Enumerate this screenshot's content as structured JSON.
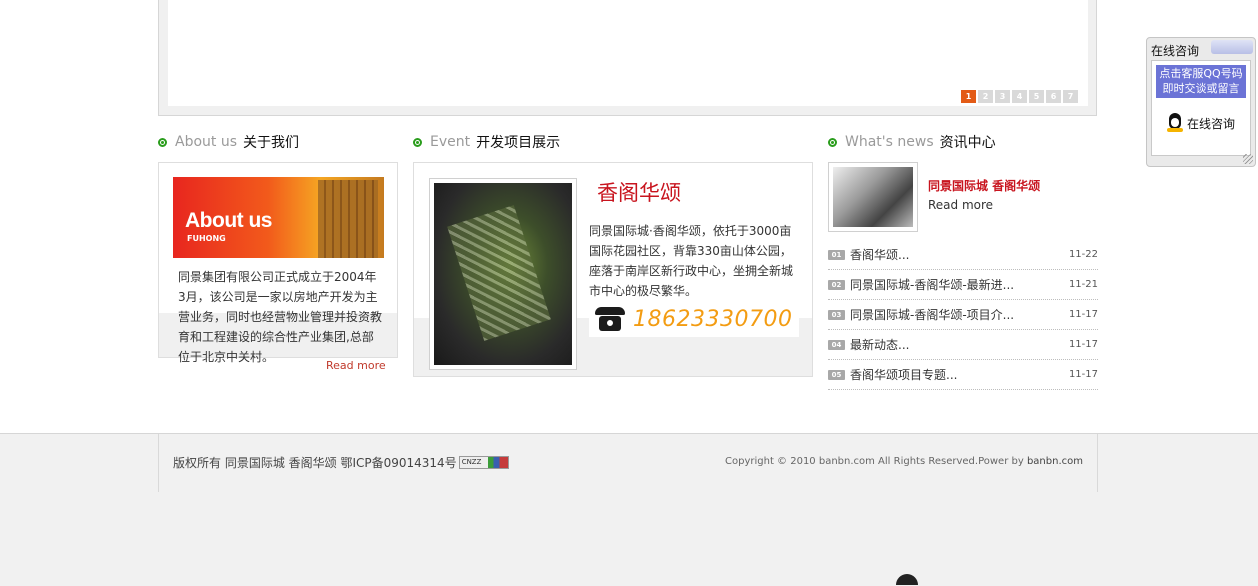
{
  "banner": {
    "pages": [
      "1",
      "2",
      "3",
      "4",
      "5",
      "6",
      "7"
    ],
    "active_page": "1"
  },
  "about": {
    "heading_en": "About us",
    "heading_cn": "关于我们",
    "image_title": "About us",
    "image_subtitle": "FUHONG",
    "text": "同景集团有限公司正式成立于2004年3月，该公司是一家以房地产开发为主营业务，同时也经营物业管理并投资教育和工程建设的综合性产业集团,总部位于北京中关村。",
    "read_more": "Read more"
  },
  "event": {
    "heading_en": "Event",
    "heading_cn": "开发项目展示",
    "project_title": "香阁华颂",
    "text": "同景国际城·香阁华颂，依托于3000亩国际花园社区，背靠330亩山体公园，座落于南岸区新行政中心，坐拥全新城市中心的极尽繁华。",
    "phone": "18623330700"
  },
  "news": {
    "heading_en": "What's news",
    "heading_cn": "资讯中心",
    "feature_title": "同景国际城 香阁华颂",
    "feature_more": "Read more",
    "items": [
      {
        "num": "01",
        "title": "香阁华颂...",
        "date": "11-22"
      },
      {
        "num": "02",
        "title": "同景国际城-香阁华颂-最新进...",
        "date": "11-21"
      },
      {
        "num": "03",
        "title": "同景国际城-香阁华颂-项目介...",
        "date": "11-17"
      },
      {
        "num": "04",
        "title": "最新动态...",
        "date": "11-17"
      },
      {
        "num": "05",
        "title": "香阁华颂项目专题...",
        "date": "11-17"
      }
    ]
  },
  "footer": {
    "left": "版权所有  同景国际城  香阁华颂  鄂ICP备09014314号",
    "cnzz": "CNZZ",
    "right_prefix": "Copyright © 2010 banbn.com All Rights Reserved.Power by ",
    "right_brand": "banbn.com"
  },
  "qq": {
    "title": "在线咨询",
    "line1": "点击客服QQ号码",
    "line2": "即时交谈或留言",
    "button": "在线咨询"
  }
}
